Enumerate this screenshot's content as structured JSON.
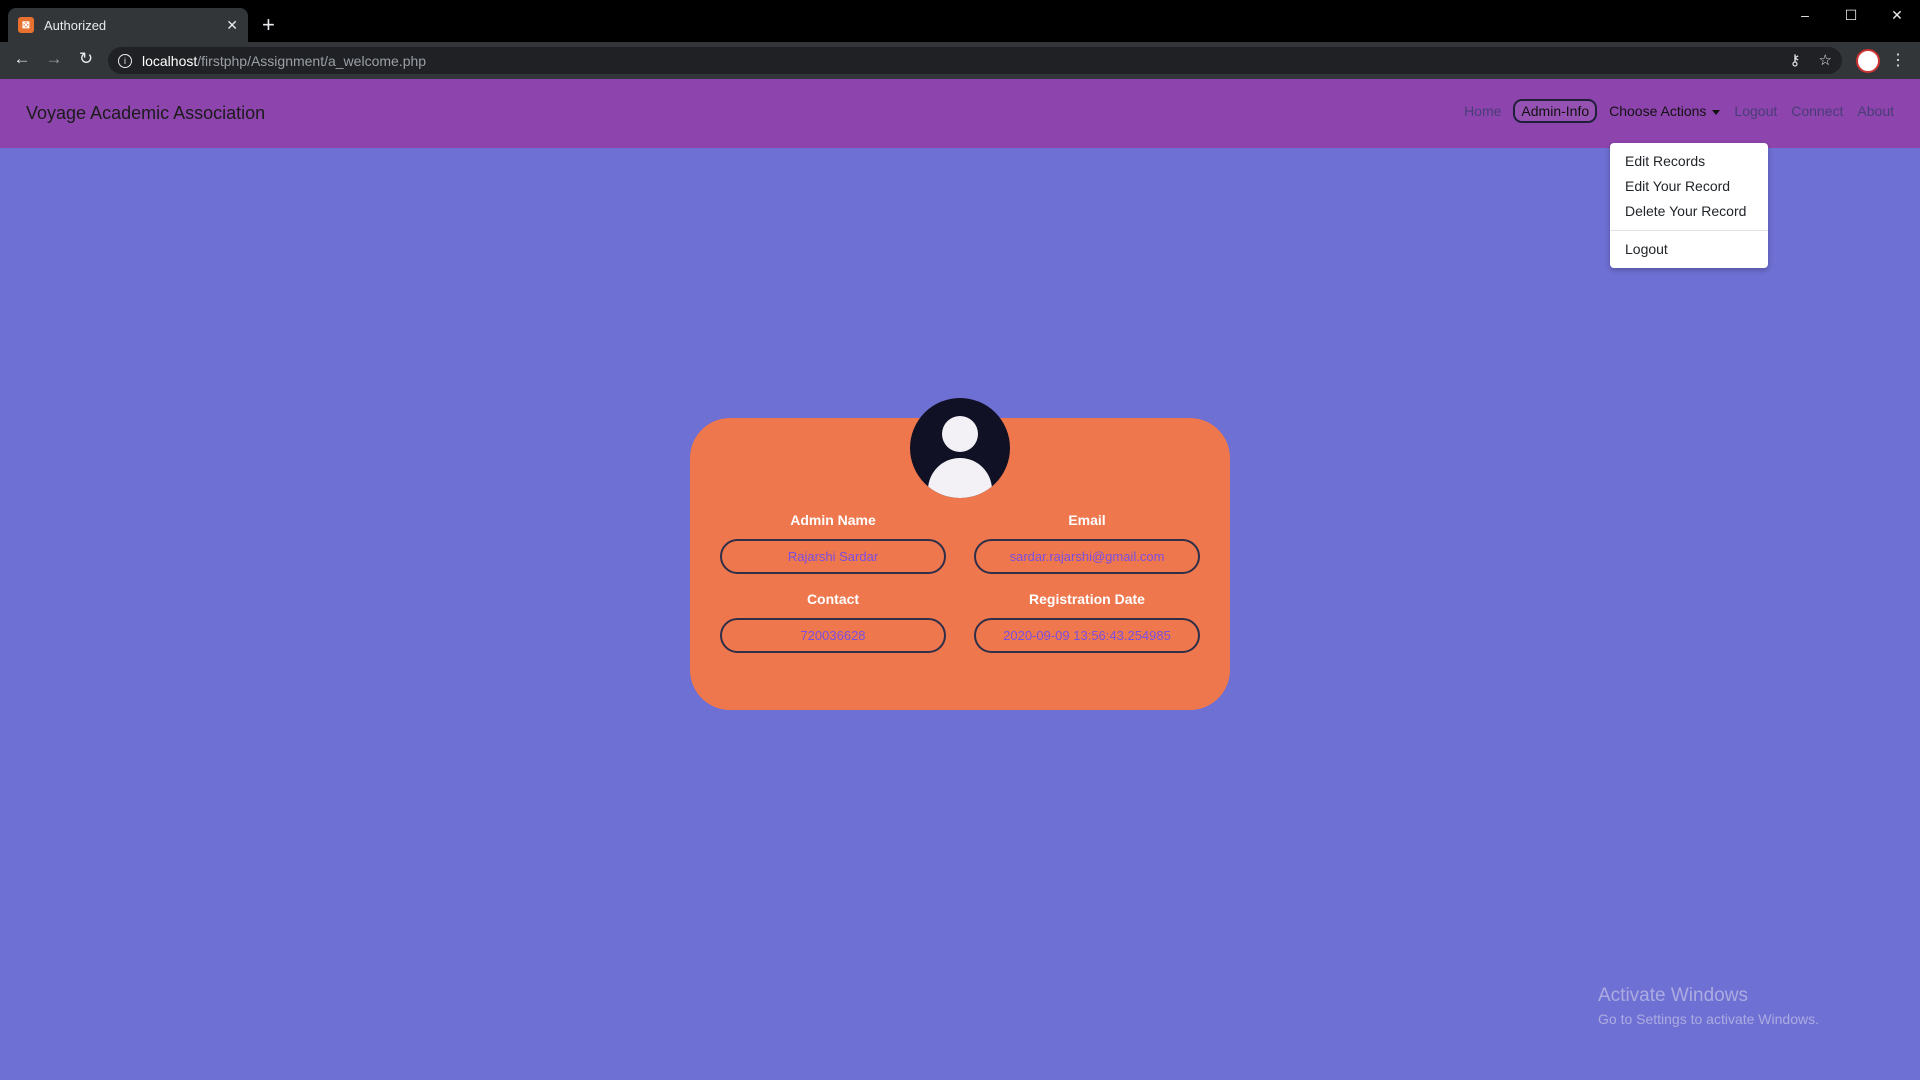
{
  "browser": {
    "tab_title": "Authorized",
    "tab_close": "✕",
    "new_tab": "+",
    "url_host": "localhost",
    "url_path": "/firstphp/Assignment/a_welcome.php",
    "window_controls": {
      "minimize": "–",
      "maximize": "☐",
      "close": "✕"
    }
  },
  "navbar": {
    "brand": "Voyage Academic Association",
    "links": {
      "home": "Home",
      "admin_info": "Admin-Info",
      "choose_actions": "Choose Actions",
      "logout": "Logout",
      "connect": "Connect",
      "about": "About"
    }
  },
  "dropdown": {
    "items": [
      "Edit Records",
      "Edit Your Record",
      "Delete Your Record"
    ],
    "logout": "Logout"
  },
  "profile_card": {
    "admin_name": {
      "label": "Admin Name",
      "value": "Rajarshi Sardar"
    },
    "email": {
      "label": "Email",
      "value": "sardar.rajarshi@gmail.com"
    },
    "contact": {
      "label": "Contact",
      "value": "720036628"
    },
    "registration_date": {
      "label": "Registration Date",
      "value": "2020-09-09 13:56:43.254985"
    }
  },
  "watermark": {
    "title": "Activate Windows",
    "subtitle": "Go to Settings to activate Windows."
  },
  "colors": {
    "page_bg": "#6f70d4",
    "navbar_bg": "#8e44ad",
    "card_bg": "#ee774d",
    "value_text": "#7b4fe0"
  }
}
